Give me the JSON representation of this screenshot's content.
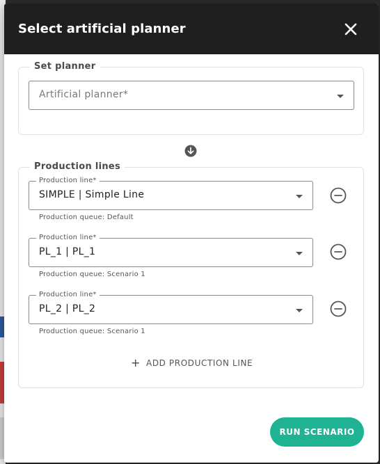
{
  "dialog": {
    "title": "Select artificial planner",
    "close_icon": "close-icon"
  },
  "set_planner": {
    "legend": "Set planner",
    "select_placeholder": "Artificial planner*"
  },
  "divider_icon": "arrow-down-circle-icon",
  "production_lines": {
    "legend": "Production lines",
    "items": [
      {
        "field_label": "Production line*",
        "value": "SIMPLE | Simple Line",
        "queue": "Production queue: Default"
      },
      {
        "field_label": "Production line*",
        "value": "PL_1 | PL_1",
        "queue": "Production queue: Scenario 1"
      },
      {
        "field_label": "Production line*",
        "value": "PL_2 | PL_2",
        "queue": "Production queue: Scenario 1"
      }
    ],
    "add_label": "ADD PRODUCTION LINE"
  },
  "run_button_label": "RUN SCENARIO",
  "colors": {
    "header_bg": "#1f1f1f",
    "accent": "#1fb394",
    "border": "#8a8a8a"
  }
}
